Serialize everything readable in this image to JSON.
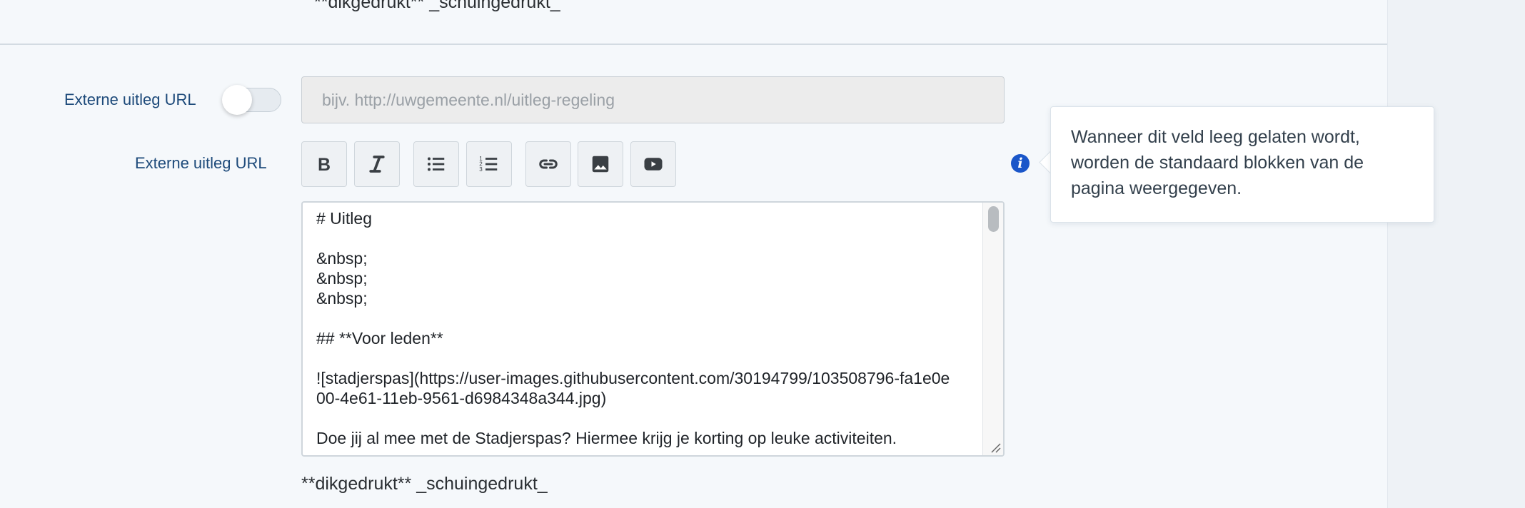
{
  "top_hint": "**dikgedrukt** _schuingedrukt_",
  "external_url_row": {
    "label": "Externe uitleg URL",
    "toggle_on": false,
    "input_placeholder": "bijv. http://uwgemeente.nl/uitleg-regeling",
    "input_value": ""
  },
  "editor_row": {
    "label": "Externe uitleg URL",
    "toolbar": [
      {
        "name": "bold-button",
        "icon": "bold-icon"
      },
      {
        "name": "italic-button",
        "icon": "italic-icon"
      },
      {
        "name": "unordered-list-button",
        "icon": "unordered-list-icon"
      },
      {
        "name": "ordered-list-button",
        "icon": "ordered-list-icon"
      },
      {
        "name": "link-button",
        "icon": "link-icon"
      },
      {
        "name": "image-button",
        "icon": "image-icon"
      },
      {
        "name": "video-button",
        "icon": "video-icon"
      }
    ],
    "content": "# Uitleg\n\n&nbsp;\n&nbsp;\n&nbsp;\n\n## **Voor leden**\n\n![stadjerspas](https://user-images.githubusercontent.com/30194799/103508796-fa1e0e00-4e61-11eb-9561-d6984348a344.jpg)\n\nDoe jij al mee met de Stadjerspas? Hiermee krijg je korting op leuke activiteiten.",
    "footer_hint": "**dikgedrukt** _schuingedrukt_"
  },
  "tooltip": {
    "icon": "info-icon",
    "text": "Wanneer dit veld leeg gelaten wordt, worden de standaard blokken van de pagina weergegeven."
  },
  "colors": {
    "label": "#1d4a7a",
    "info_icon": "#1a56c9",
    "background": "#f5f8fb"
  }
}
